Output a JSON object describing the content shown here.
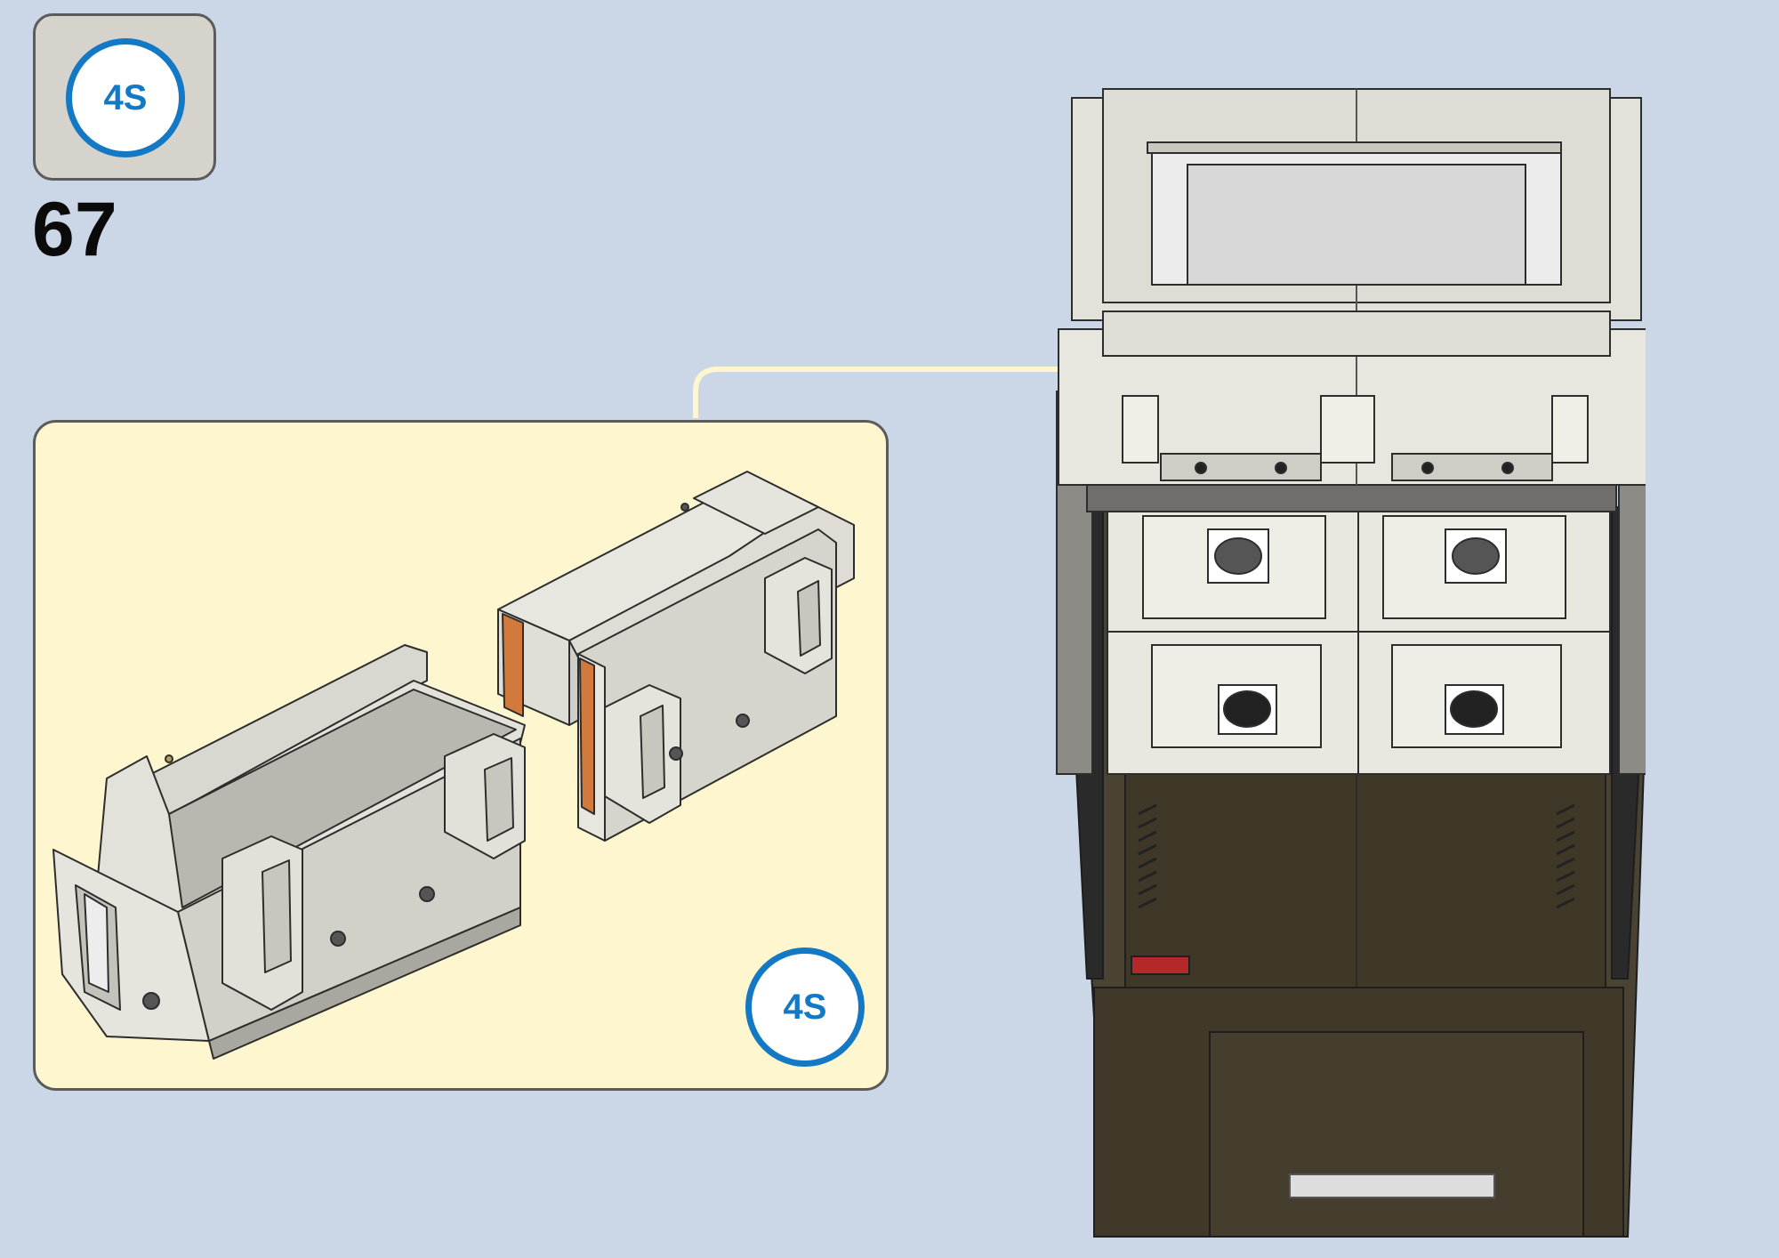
{
  "step": {
    "number": "67"
  },
  "part_badge": {
    "label": "4S"
  },
  "callout": {
    "badge_label": "4S"
  },
  "colors": {
    "background": "#cbd7e6",
    "callout_fill": "#fdf6cf",
    "badge_blue": "#1479c5",
    "arrow": "#fdf6cf",
    "accent_orange": "#d27a3b"
  },
  "icons": [
    "part-badge-circle",
    "callout-arrow"
  ]
}
